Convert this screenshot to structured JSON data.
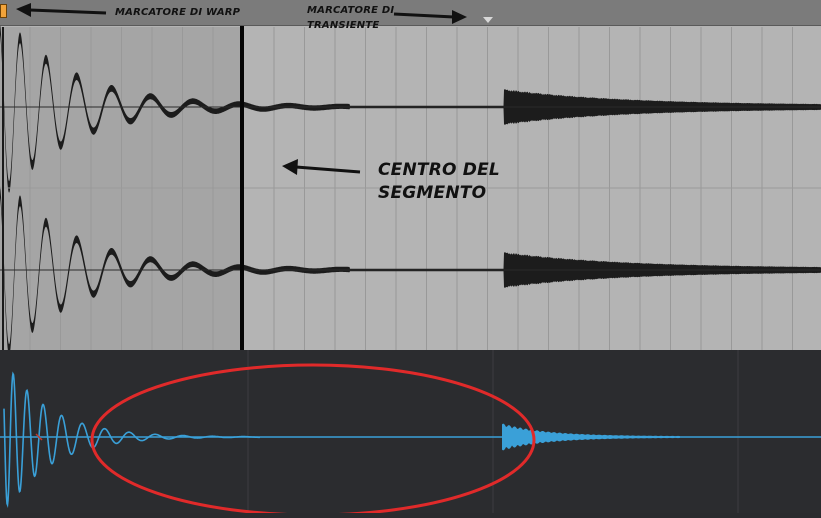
{
  "annotations": {
    "warp_marker_label": "MARCATORE DI WARP",
    "transient_marker_label_line1": "MARCATORE DI",
    "transient_marker_label_line2": "TRANSIENTE",
    "segment_center_label_line1": "CENTRO DEL",
    "segment_center_label_line2": "SEGMENTO"
  },
  "colors": {
    "editor_background": "#b4b4b4",
    "selected_region": "#a5a5a5",
    "ruler": "#7b7b7b",
    "waveform": "#1c1c1c",
    "overview_background": "#2b2c2f",
    "overview_waveform": "#3aa0d8",
    "warp_marker": "#f3a43a",
    "highlight_ellipse": "#e02a2a"
  },
  "icons": {
    "warp_marker": "warp-marker-flag-icon",
    "transient_marker": "transient-marker-triangle-icon",
    "annotation_arrow": "arrow-icon"
  }
}
